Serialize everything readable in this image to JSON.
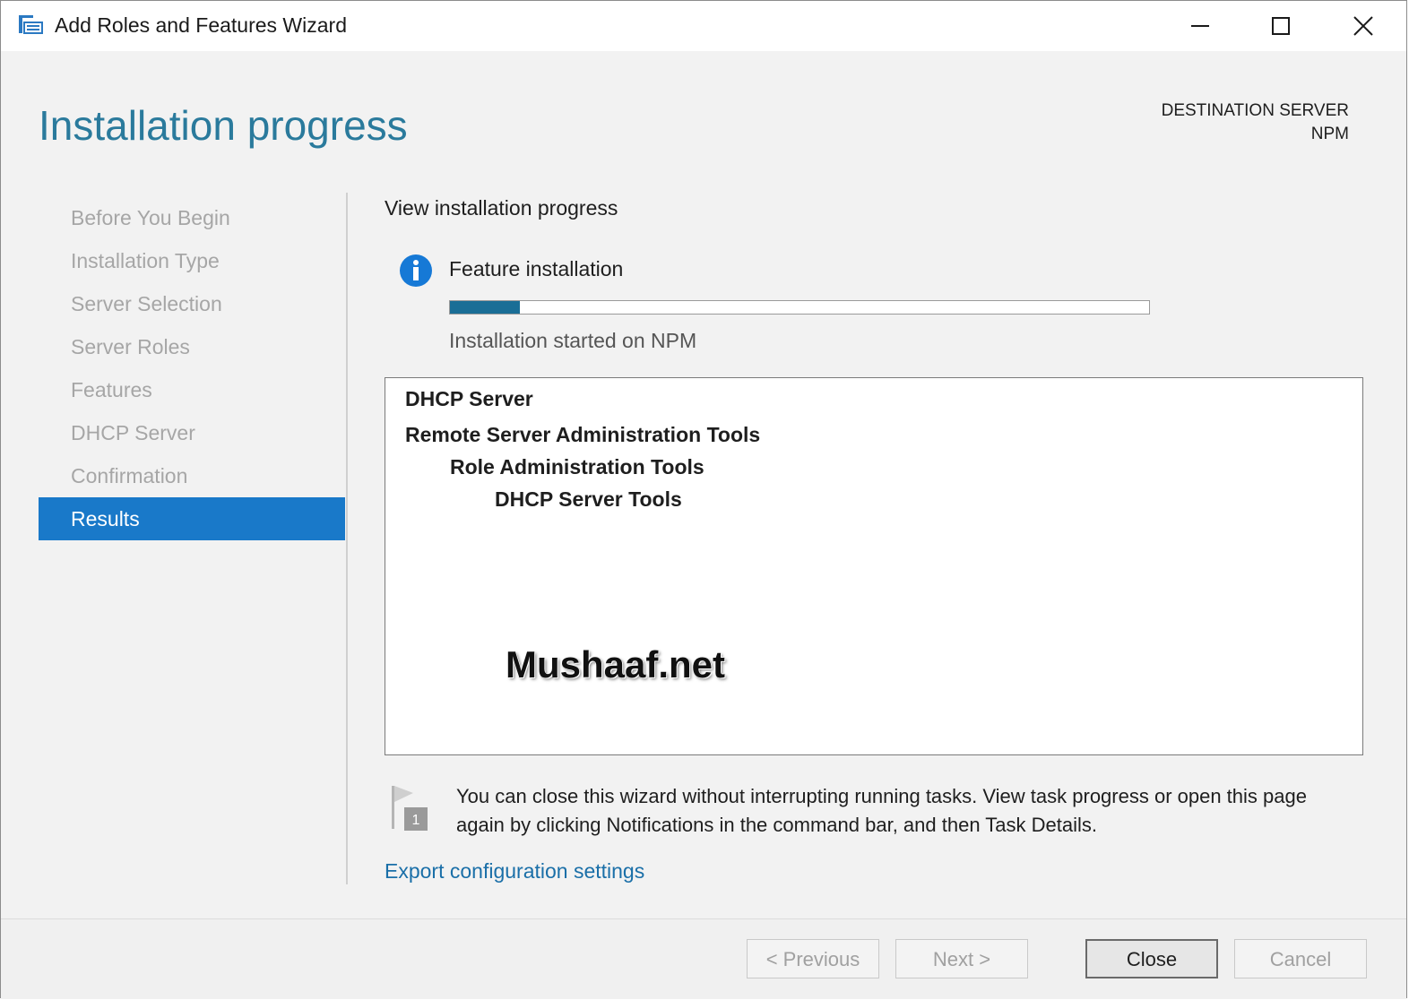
{
  "window": {
    "title": "Add Roles and Features Wizard"
  },
  "header": {
    "page_title": "Installation progress",
    "destination_label": "DESTINATION SERVER",
    "destination_server": "NPM"
  },
  "nav": {
    "items": [
      {
        "label": "Before You Begin",
        "active": false
      },
      {
        "label": "Installation Type",
        "active": false
      },
      {
        "label": "Server Selection",
        "active": false
      },
      {
        "label": "Server Roles",
        "active": false
      },
      {
        "label": "Features",
        "active": false
      },
      {
        "label": "DHCP Server",
        "active": false
      },
      {
        "label": "Confirmation",
        "active": false
      },
      {
        "label": "Results",
        "active": true
      }
    ]
  },
  "main": {
    "section_title": "View installation progress",
    "feature_title": "Feature installation",
    "progress_fraction": 0.1,
    "progress_status": "Installation started on NPM",
    "results": [
      {
        "label": "DHCP Server",
        "level": 0
      },
      {
        "label": "Remote Server Administration Tools",
        "level": 0
      },
      {
        "label": "Role Administration Tools",
        "level": 1
      },
      {
        "label": "DHCP Server Tools",
        "level": 2
      }
    ],
    "watermark": "Mushaaf.net",
    "note_badge": "1",
    "note_text": "You can close this wizard without interrupting running tasks. View task progress or open this page again by clicking Notifications in the command bar, and then Task Details.",
    "export_link": "Export configuration settings"
  },
  "footer": {
    "previous_label": "< Previous",
    "next_label": "Next >",
    "close_label": "Close",
    "cancel_label": "Cancel"
  },
  "colors": {
    "accent": "#1979c9",
    "title_blue": "#2a7a9c",
    "progress_fill": "#1a6e96",
    "link": "#1a6fa8"
  }
}
